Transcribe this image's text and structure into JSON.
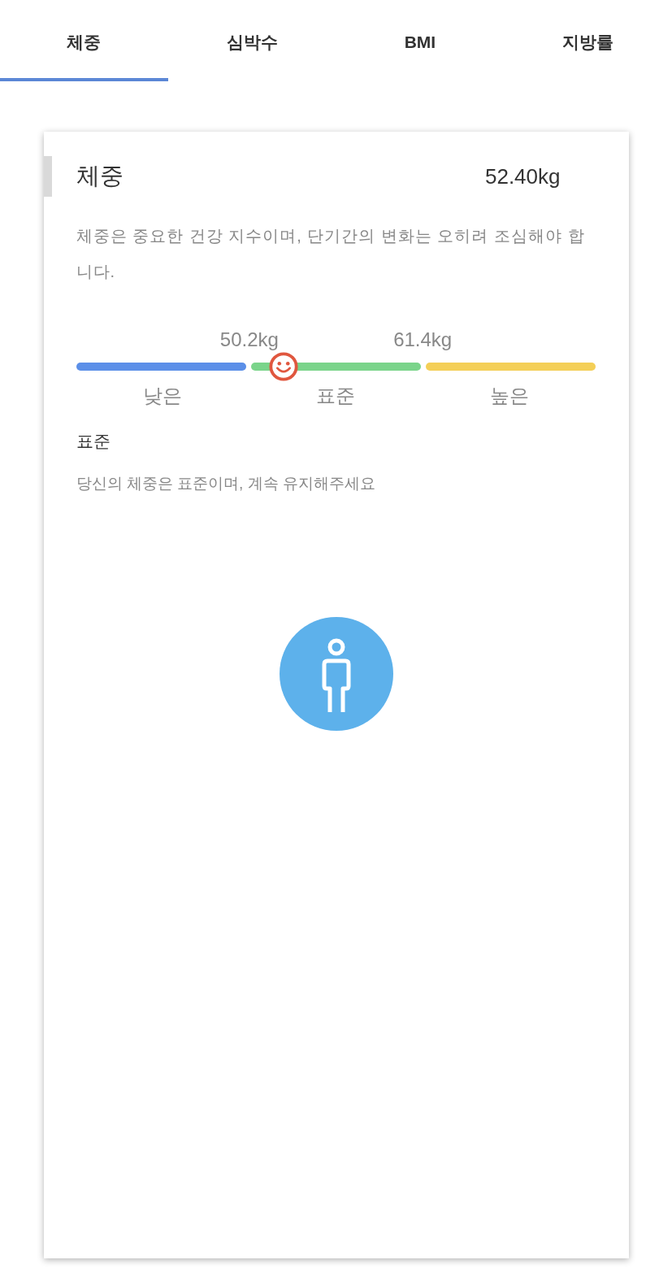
{
  "tabs": [
    {
      "label": "체중",
      "selected": true
    },
    {
      "label": "심박수",
      "selected": false
    },
    {
      "label": "BMI",
      "selected": false
    },
    {
      "label": "지방률",
      "selected": false
    }
  ],
  "card": {
    "title": "체중",
    "value": "52.40kg",
    "description": "체중은 중요한 건강 지수이며, 단기간의 변화는 오히려 조심해야 합니다.",
    "thresholds": [
      "50.2kg",
      "61.4kg"
    ],
    "segments": [
      {
        "label": "낮은",
        "color": "#5b8fe8",
        "selected": false
      },
      {
        "label": "표준",
        "color": "#7ad48a",
        "selected": true
      },
      {
        "label": "높은",
        "color": "#f4cf57",
        "selected": false
      }
    ],
    "status": {
      "title": "표준",
      "message": "당신의 체중은 표준이며, 계속 유지해주세요"
    }
  }
}
